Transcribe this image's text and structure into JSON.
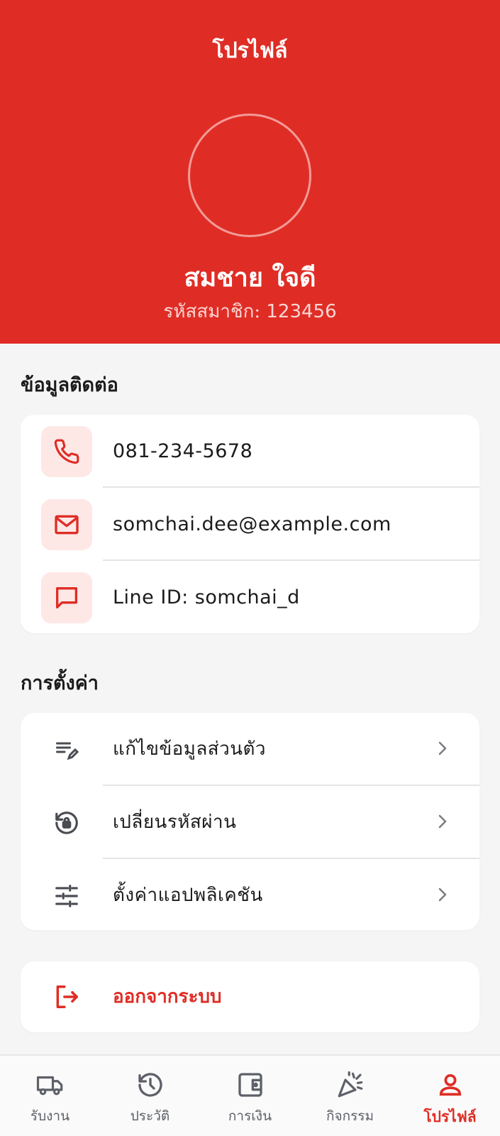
{
  "header": {
    "title": "โปรไฟล์",
    "name": "สมชาย ใจดี",
    "member_label": "รหัสสมาชิก:",
    "member_id": "123456"
  },
  "contact": {
    "title": "ข้อมูลติดต่อ",
    "items": [
      {
        "icon": "phone-icon",
        "text": "081-234-5678"
      },
      {
        "icon": "mail-icon",
        "text": "somchai.dee@example.com"
      },
      {
        "icon": "chat-icon",
        "text": "Line ID: somchai_d"
      }
    ]
  },
  "settings": {
    "title": "การตั้งค่า",
    "items": [
      {
        "icon": "edit-list-icon",
        "label": "แก้ไขข้อมูลส่วนตัว"
      },
      {
        "icon": "lock-reset-icon",
        "label": "เปลี่ยนรหัสผ่าน"
      },
      {
        "icon": "sliders-icon",
        "label": "ตั้งค่าแอปพลิเคชัน"
      }
    ]
  },
  "logout": {
    "icon": "logout-icon",
    "label": "ออกจากระบบ"
  },
  "nav": {
    "items": [
      {
        "icon": "truck-icon",
        "label": "รับงาน"
      },
      {
        "icon": "history-icon",
        "label": "ประวัติ"
      },
      {
        "icon": "wallet-icon",
        "label": "การเงิน"
      },
      {
        "icon": "party-icon",
        "label": "กิจกรรม"
      },
      {
        "icon": "user-icon",
        "label": "โปรไฟล์",
        "active": true
      }
    ]
  },
  "colors": {
    "primary": "#df2d25",
    "icon_bg": "#fde8e6",
    "background": "#f6f5f5",
    "nav_inactive": "#5d6068"
  }
}
